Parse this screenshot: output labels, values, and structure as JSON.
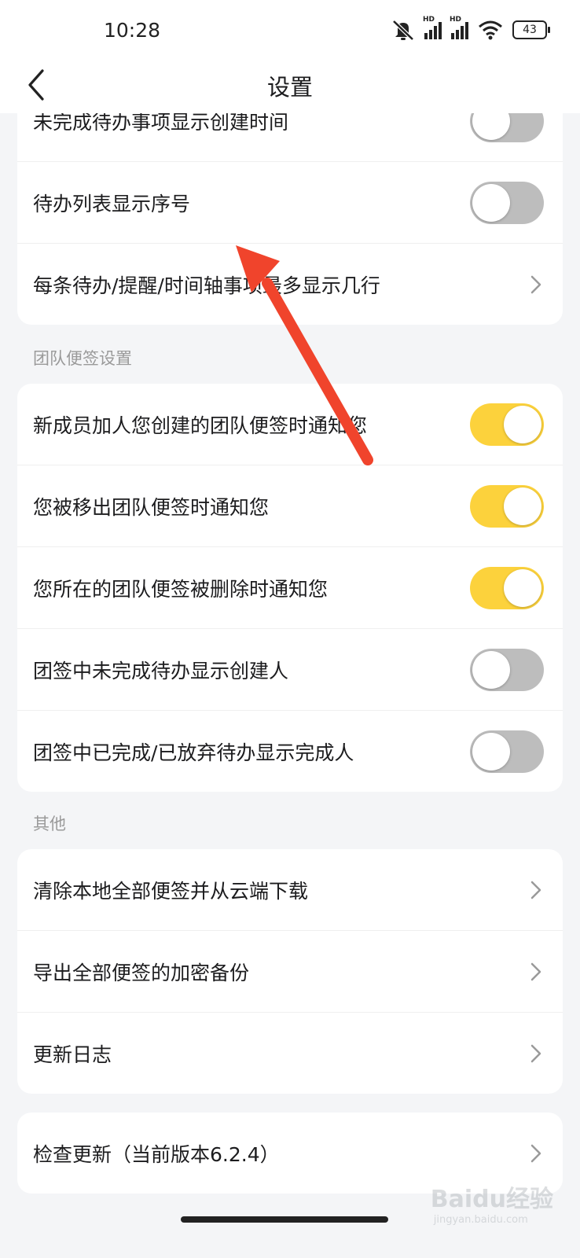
{
  "status_bar": {
    "time": "10:28",
    "battery": "43"
  },
  "header": {
    "title": "设置"
  },
  "section_top": {
    "items": [
      {
        "label": "未完成待办事项显示创建时间",
        "type": "toggle",
        "on": false
      },
      {
        "label": "待办列表显示序号",
        "type": "toggle",
        "on": false
      },
      {
        "label": "每条待办/提醒/时间轴事项最多显示几行",
        "type": "link"
      }
    ]
  },
  "section_team": {
    "title": "团队便签设置",
    "items": [
      {
        "label": "新成员加人您创建的团队便签时通知您",
        "type": "toggle",
        "on": true
      },
      {
        "label": "您被移出团队便签时通知您",
        "type": "toggle",
        "on": true
      },
      {
        "label": "您所在的团队便签被删除时通知您",
        "type": "toggle",
        "on": true
      },
      {
        "label": "团签中未完成待办显示创建人",
        "type": "toggle",
        "on": false
      },
      {
        "label": "团签中已完成/已放弃待办显示完成人",
        "type": "toggle",
        "on": false
      }
    ]
  },
  "section_other": {
    "title": "其他",
    "items": [
      {
        "label": "清除本地全部便签并从云端下载",
        "type": "link"
      },
      {
        "label": "导出全部便签的加密备份",
        "type": "link"
      },
      {
        "label": "更新日志",
        "type": "link"
      }
    ]
  },
  "section_update": {
    "items": [
      {
        "label": "检查更新（当前版本6.2.4）",
        "type": "link"
      }
    ]
  },
  "watermark": {
    "main": "Baidu经验",
    "sub": "jingyan.baidu.com"
  },
  "colors": {
    "toggle_on": "#fcd23c",
    "toggle_off": "#bdbdbd",
    "arrow": "#f0442c",
    "background": "#f4f5f7"
  }
}
